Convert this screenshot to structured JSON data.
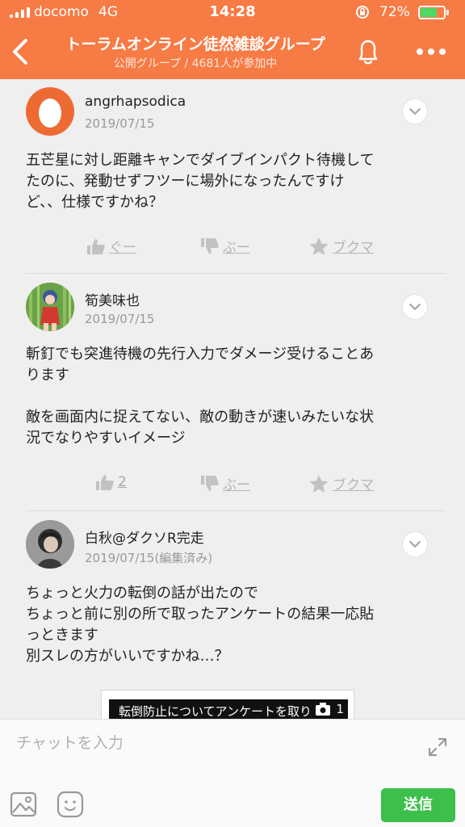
{
  "status_bar": {
    "carrier": "docomo",
    "network": "4G",
    "time": "14:28",
    "battery": "72%",
    "battery_level": 0.72
  },
  "header": {
    "title": "トーラムオンライン徒然雑談グループ",
    "subtitle": "公開グループ / 4681人が参加中",
    "icons": [
      "back-chevron-icon",
      "bell-icon",
      "more-dots-icon"
    ]
  },
  "posts": [
    {
      "author": "angrhapsodica",
      "date": "2019/07/15",
      "body": [
        "五芒星に対し距離キャンでダイブインパクト待機して",
        "たのに、発動せずフツーに場外になったんですけ",
        "ど、、仕様ですかね？"
      ],
      "like": "ぐー",
      "dislike": "ぶー",
      "bookmark": "ブクマ"
    },
    {
      "author": "筍美味也",
      "date": "2019/07/15",
      "body": [
        "斬釘でも突進待機の先行入力でダメージ受けることあ",
        "ります",
        "",
        "敵を画面内に捉えてない、敵の動きが速いみたいな状",
        "況でなりやすいイメージ"
      ],
      "like": "2",
      "dislike": "ぶー",
      "bookmark": "ブクマ"
    },
    {
      "author": "白秋@ダクソR完走",
      "date": "2019/07/15(編集済み)",
      "body": [
        "ちょっと火力の転倒の話が出たので",
        "ちょっと前に別の所で取ったアンケートの結果一応貼",
        "っときます",
        "別スレの方がいいですかね…？"
      ],
      "attachment_title": "転倒防止についてアンケートを取り",
      "attachment_count": "1"
    }
  ],
  "input": {
    "placeholder": "チャットを入力",
    "send_label": "送信"
  },
  "colors": {
    "brand": "#f77b45",
    "send": "#3cbf4b"
  }
}
